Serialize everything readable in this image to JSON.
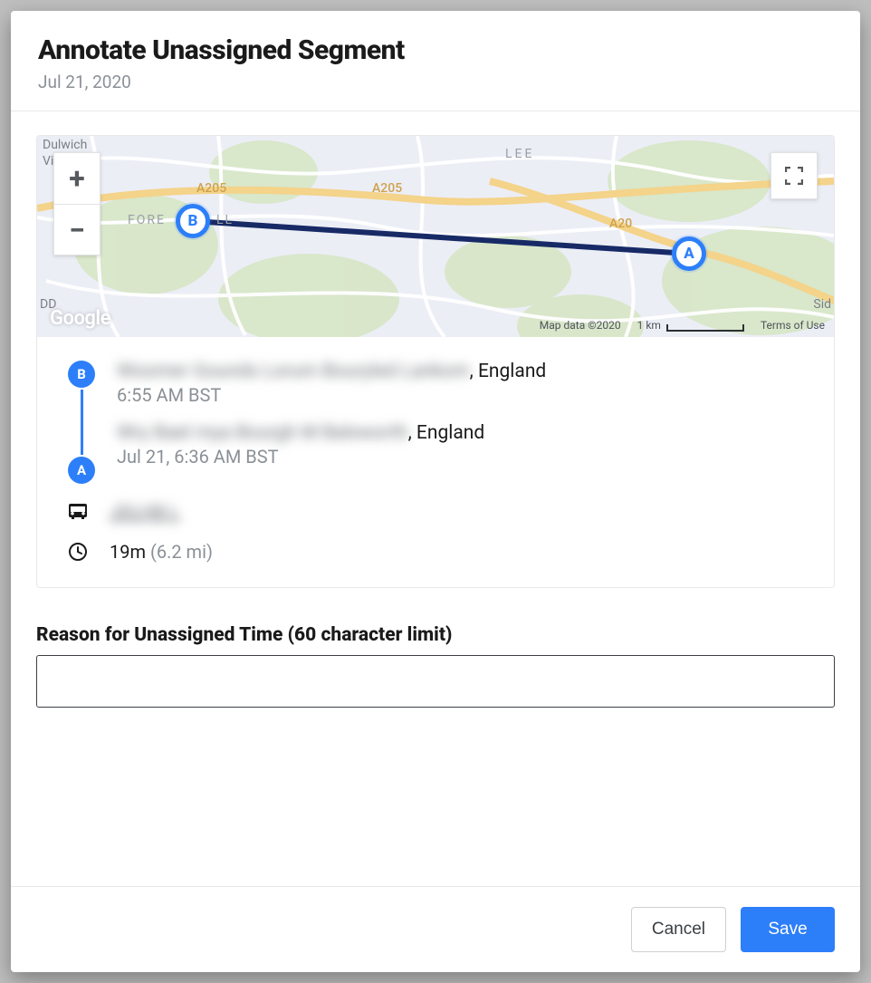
{
  "header": {
    "title": "Annotate Unassigned Segment",
    "subtitle": "Jul 21, 2020"
  },
  "map": {
    "zoom_in": "+",
    "zoom_out": "−",
    "logo": "Google",
    "attribution": "Map data ©2020",
    "scale_label": "1 km",
    "terms": "Terms of Use",
    "labels": {
      "dulwich": "Dulwich",
      "vi": "Vi",
      "fore": "FORE",
      "ll": "LL",
      "lee": "LEE",
      "a205_left": "A205",
      "a205_right": "A205",
      "a20": "A20",
      "dd": "DD",
      "sid": "Sid"
    },
    "markers": {
      "a": "A",
      "b": "B"
    }
  },
  "segment": {
    "stops": [
      {
        "marker": "B",
        "address_blurred": "Woomer Gounds Lorum Bouryled Lankom",
        "address_suffix": ", England",
        "timestamp": "6:55 AM BST"
      },
      {
        "marker": "A",
        "address_blurred": "Wry Bael mya Bourgh M Balsworth",
        "address_suffix": ", England",
        "timestamp": "Jul 21, 6:36 AM BST"
      }
    ],
    "vehicle_blurred": "JDLHB L",
    "duration": "19m",
    "distance": "(6.2 mi)"
  },
  "form": {
    "reason_label": "Reason for Unassigned Time (60 character limit)",
    "reason_value": ""
  },
  "footer": {
    "cancel": "Cancel",
    "save": "Save"
  }
}
